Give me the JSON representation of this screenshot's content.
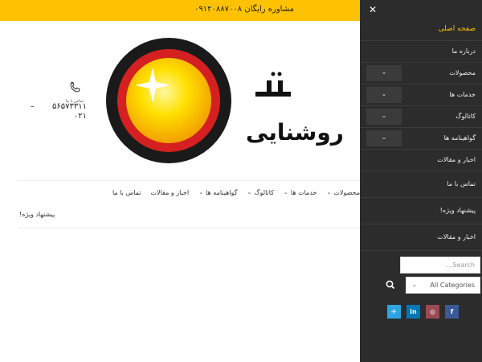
{
  "topbar": {
    "promo": "مشاوره رایگان ۰۹۱۲۰۸۸۷۰۰۸"
  },
  "header": {
    "logo_text_bottom": "روشنایی",
    "contact_label": "تماس با ما",
    "phone_line1": "۵۶۵۷۳۳۱۱",
    "phone_line2": "۰۲۱",
    "phone_dash": "–"
  },
  "mainnav": {
    "items": [
      {
        "label": "محصولات",
        "chev": "⌄"
      },
      {
        "label": "خدمات ها",
        "chev": "⌄"
      },
      {
        "label": "کاتالوگ",
        "chev": "⌄"
      },
      {
        "label": "گواهینامه ها",
        "chev": "⌄"
      },
      {
        "label": "اخبار و مقالات",
        "chev": ""
      },
      {
        "label": "تماس با ما",
        "chev": ""
      }
    ]
  },
  "special_offer": "پیشنهاد ویژه!",
  "drawer": {
    "close": "✕",
    "menu": [
      {
        "label": "صفحه اصلی",
        "toggle": "",
        "active": true
      },
      {
        "label": "درباره ما",
        "toggle": ""
      },
      {
        "label": "محصولات",
        "toggle": "⌄"
      },
      {
        "label": "خدمات ها",
        "toggle": "⌄"
      },
      {
        "label": "کاتالوگ",
        "toggle": "⌄"
      },
      {
        "label": "گواهینامه ها",
        "toggle": "⌄"
      },
      {
        "label": "اخبار و مقالات",
        "toggle": ""
      },
      {
        "label": "تماس با ما",
        "toggle": ""
      },
      {
        "label": "پیشنهاد ویژه!",
        "toggle": ""
      },
      {
        "label": "اخبار و مقالات",
        "toggle": ""
      }
    ],
    "search_placeholder": "...Search",
    "category_value": "All Categories",
    "category_arrow": "⌄",
    "socials": [
      {
        "icon": "telegram-icon",
        "glyph": "✈",
        "color": "#2ca5e0"
      },
      {
        "icon": "linkedin-icon",
        "glyph": "in",
        "color": "#0077b5"
      },
      {
        "icon": "instagram-icon",
        "glyph": "◎",
        "color": "#c13584"
      },
      {
        "icon": "facebook-icon",
        "glyph": "f",
        "color": "#3b5998"
      }
    ]
  },
  "colors": {
    "accent": "#ffc200",
    "drawer_bg": "#2c2c2c"
  }
}
